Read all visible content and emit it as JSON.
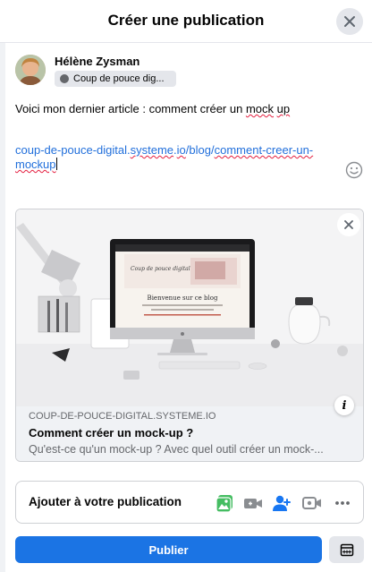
{
  "dialog": {
    "title": "Créer une publication",
    "close_icon": "close-icon"
  },
  "author": {
    "name": "Hélène Zysman",
    "audience": "Coup de pouce dig...",
    "audience_icon": "group-icon"
  },
  "post": {
    "text_parts": [
      "Voici mon dernier article : comment créer un ",
      "mock",
      " ",
      "up"
    ],
    "link_parts": [
      "coup-de-pouce-digital.",
      "systeme",
      ".",
      "io",
      "/blog/",
      "comment-creer-un-",
      "mockup"
    ],
    "emoji_icon": "smiley-icon"
  },
  "preview": {
    "image_icon": "imac-desk-photo",
    "screen_header": "Coup de pouce digital",
    "screen_headline": "Bienvenue sur ce blog",
    "domain": "COUP-DE-POUCE-DIGITAL.SYSTEME.IO",
    "title": "Comment créer un mock-up ?",
    "description": "Qu'est-ce qu'un mock-up ? Avec quel outil créer un mock-...",
    "info_label": "i",
    "close_icon": "close-icon"
  },
  "add_to_post": {
    "label": "Ajouter à votre publication",
    "icons": [
      "photo-video-icon",
      "video-camera-icon",
      "tag-people-icon",
      "live-video-icon",
      "more-dots-icon"
    ]
  },
  "actions": {
    "publish_label": "Publier",
    "schedule_icon": "calendar-icon"
  },
  "colors": {
    "accent": "#1b74e4",
    "link": "#216fdb",
    "spellcheck": "#e41e3f",
    "photo_icon": "#45bd62",
    "tag_icon": "#1877f2",
    "secondary_text": "#65676b"
  }
}
